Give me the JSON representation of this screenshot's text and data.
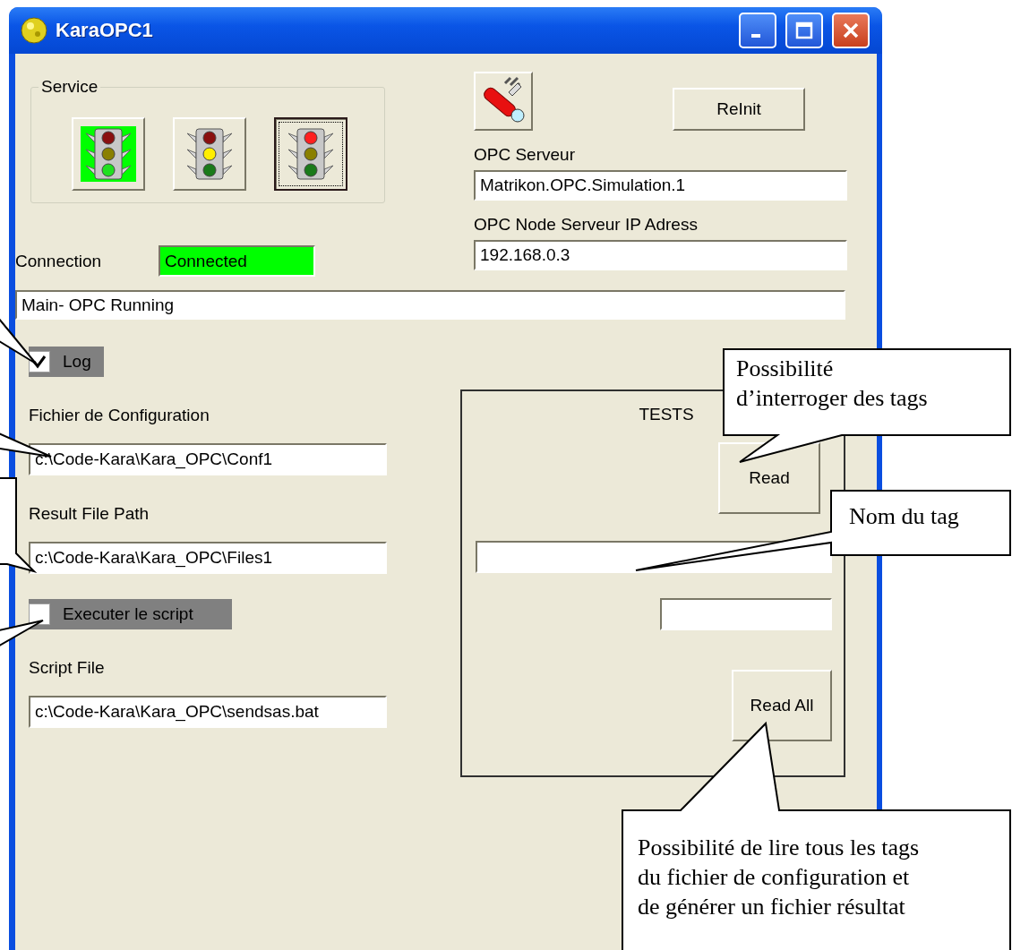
{
  "window": {
    "title": "KaraOPC1"
  },
  "service": {
    "label": "Service",
    "buttons": [
      {
        "kind": "green",
        "on": true,
        "focused": false
      },
      {
        "kind": "yellow",
        "on": false,
        "focused": false
      },
      {
        "kind": "red",
        "on": false,
        "focused": true
      }
    ]
  },
  "reinit_button": "ReInit",
  "server": {
    "label": "OPC Serveur",
    "value": "Matrikon.OPC.Simulation.1"
  },
  "node": {
    "label": "OPC Node Serveur IP Adress",
    "value": "192.168.0.3"
  },
  "connection": {
    "label": "Connection",
    "value": "Connected",
    "connected": true
  },
  "status": "Main- OPC Running",
  "log": {
    "label": "Log",
    "checked": true
  },
  "config_file": {
    "label": "Fichier de Configuration",
    "value": "c:\\Code-Kara\\Kara_OPC\\Conf1"
  },
  "result_path": {
    "label": "Result File Path",
    "value": "c:\\Code-Kara\\Kara_OPC\\Files1"
  },
  "run_script": {
    "label": "Executer le script",
    "checked": false
  },
  "script_file": {
    "label": "Script File",
    "value": "c:\\Code-Kara\\Kara_OPC\\sendsas.bat"
  },
  "tests": {
    "title": "TESTS",
    "read_button": "Read",
    "inputs": [
      {
        "kind": "wide"
      },
      {
        "kind": "narrow"
      }
    ],
    "read_all_button": "Read All"
  },
  "callouts": [
    {
      "text": "Possibilité\nd’interroger des tags"
    },
    {
      "text": "Nom du tag"
    },
    {
      "text": "Possibilité de lire tous les tags\ndu fichier de configuration et\nde générer un fichier résultat"
    }
  ]
}
